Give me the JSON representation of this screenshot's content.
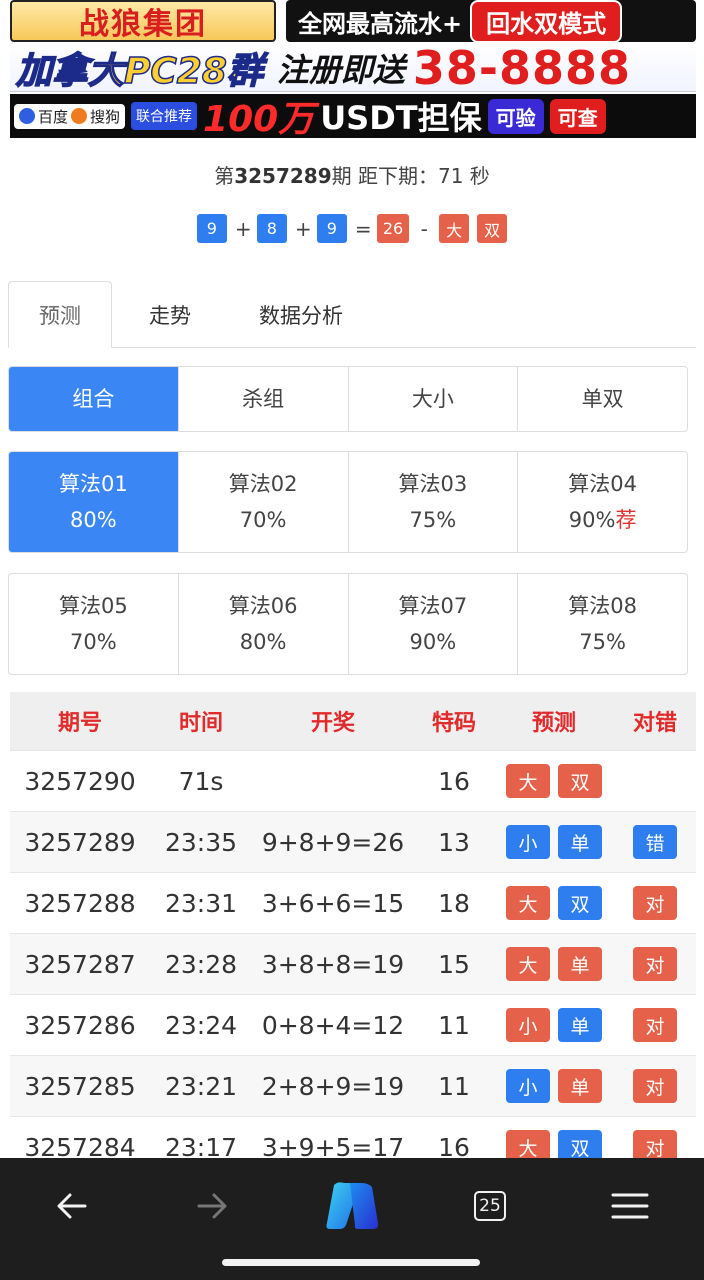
{
  "banner": {
    "brand": "战狼集团",
    "top_slogan": "全网最高流水+",
    "top_pill": "回水双模式",
    "mid_group": "加拿大PC28群",
    "mid_register": "注册即送",
    "mid_amount": "38-8888",
    "engine1": "百度",
    "engine2": "搜狗",
    "tag": "联合推荐",
    "guarantee_amount": "100万",
    "guarantee_text": "USDT担保",
    "btn_verify": "可验",
    "btn_check": "可查"
  },
  "period": {
    "prefix": "第",
    "number": "3257289",
    "suffix": "期 距下期：71 秒"
  },
  "result": {
    "n1": "9",
    "op1": "+",
    "n2": "8",
    "op2": "+",
    "n3": "9",
    "eq": "=",
    "sum": "26",
    "dash": "-",
    "size": "大",
    "parity": "双"
  },
  "tabs": [
    "预测",
    "走势",
    "数据分析"
  ],
  "modes": [
    "组合",
    "杀组",
    "大小",
    "单双"
  ],
  "algorithms": [
    {
      "name": "算法01",
      "rate": "80%",
      "rec": ""
    },
    {
      "name": "算法02",
      "rate": "70%",
      "rec": ""
    },
    {
      "name": "算法03",
      "rate": "75%",
      "rec": ""
    },
    {
      "name": "算法04",
      "rate": "90%",
      "rec": "荐"
    },
    {
      "name": "算法05",
      "rate": "70%",
      "rec": ""
    },
    {
      "name": "算法06",
      "rate": "80%",
      "rec": ""
    },
    {
      "name": "算法07",
      "rate": "90%",
      "rec": ""
    },
    {
      "name": "算法08",
      "rate": "75%",
      "rec": ""
    }
  ],
  "table": {
    "headers": [
      "期号",
      "时间",
      "开奖",
      "特码",
      "预测",
      "对错"
    ],
    "rows": [
      {
        "issue": "3257290",
        "time": "71s",
        "draw": "",
        "code": "16",
        "pred": [
          {
            "t": "大",
            "c": "red"
          },
          {
            "t": "双",
            "c": "red"
          }
        ],
        "result": null
      },
      {
        "issue": "3257289",
        "time": "23:35",
        "draw": "9+8+9=26",
        "code": "13",
        "pred": [
          {
            "t": "小",
            "c": "blue"
          },
          {
            "t": "单",
            "c": "blue"
          }
        ],
        "result": {
          "t": "错",
          "c": "blue"
        }
      },
      {
        "issue": "3257288",
        "time": "23:31",
        "draw": "3+6+6=15",
        "code": "18",
        "pred": [
          {
            "t": "大",
            "c": "red"
          },
          {
            "t": "双",
            "c": "blue"
          }
        ],
        "result": {
          "t": "对",
          "c": "red"
        }
      },
      {
        "issue": "3257287",
        "time": "23:28",
        "draw": "3+8+8=19",
        "code": "15",
        "pred": [
          {
            "t": "大",
            "c": "red"
          },
          {
            "t": "单",
            "c": "red"
          }
        ],
        "result": {
          "t": "对",
          "c": "red"
        }
      },
      {
        "issue": "3257286",
        "time": "23:24",
        "draw": "0+8+4=12",
        "code": "11",
        "pred": [
          {
            "t": "小",
            "c": "red"
          },
          {
            "t": "单",
            "c": "blue"
          }
        ],
        "result": {
          "t": "对",
          "c": "red"
        }
      },
      {
        "issue": "3257285",
        "time": "23:21",
        "draw": "2+8+9=19",
        "code": "11",
        "pred": [
          {
            "t": "小",
            "c": "blue"
          },
          {
            "t": "单",
            "c": "red"
          }
        ],
        "result": {
          "t": "对",
          "c": "red"
        }
      },
      {
        "issue": "3257284",
        "time": "23:17",
        "draw": "3+9+5=17",
        "code": "16",
        "pred": [
          {
            "t": "大",
            "c": "red"
          },
          {
            "t": "双",
            "c": "blue"
          }
        ],
        "result": {
          "t": "对",
          "c": "red"
        }
      }
    ]
  },
  "browser": {
    "tab_count": "25",
    "icons": [
      "back-arrow-icon",
      "forward-arrow-icon",
      "copilot-icon",
      "tabs-icon",
      "menu-icon"
    ]
  },
  "colors": {
    "accent_blue": "#3a86f5",
    "red": "#e6614a",
    "header_red": "#e22a2a"
  }
}
